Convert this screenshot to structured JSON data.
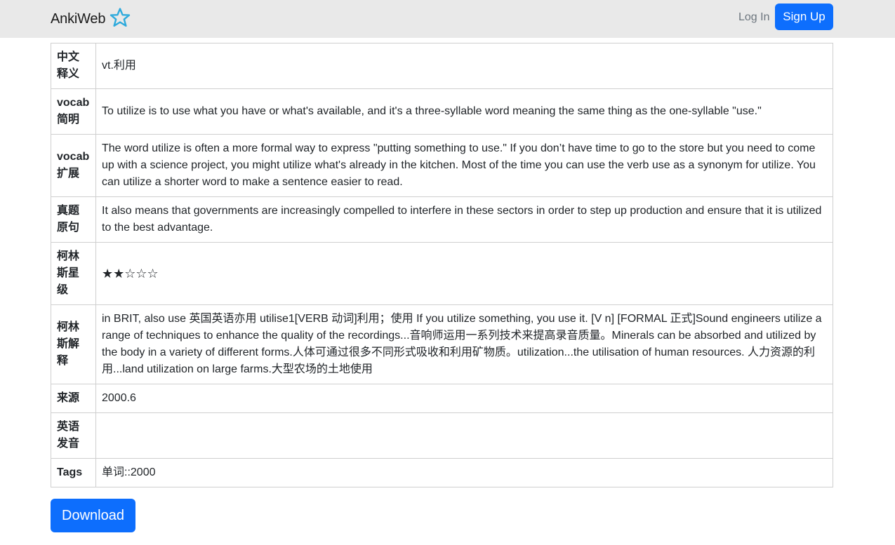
{
  "navbar": {
    "brand": "AnkiWeb",
    "brand_icon": "anki-star-icon",
    "brand_icon_color": "#2eaadc",
    "login_label": "Log In",
    "signup_label": "Sign Up",
    "accent": "#0d6efd"
  },
  "fields": [
    {
      "name": "中文释义",
      "value": "vt.利用"
    },
    {
      "name": "vocab简明",
      "value": "To utilize is to use what you have or what's available, and it's a three-syllable word meaning the same thing as the one-syllable \"use.\""
    },
    {
      "name": "vocab扩展",
      "value": "The word utilize is often a more formal way to express \"putting something to use.\" If you don’t have time to go to the store but you need to come up with a science project, you might utilize what's already in the kitchen. Most of the time you can use the verb use as a synonym for utilize. You can utilize a shorter word to make a sentence easier to read."
    },
    {
      "name": "真题原句",
      "value": "It also means that governments are increasingly compelled to interfere in these sectors in order to step up production and ensure that it is utilized to the best advantage."
    },
    {
      "name": "柯林斯星级",
      "value": "★★☆☆☆"
    },
    {
      "name": "柯林斯解释",
      "value": "in BRIT, also use 英国英语亦用 utilise1[VERB 动词]利用；使用 If you utilize something, you use it.   [V n]  [FORMAL 正式]Sound engineers utilize a range of techniques to enhance the quality of the recordings...音响师运用一系列技术来提高录音质量。Minerals can be absorbed and utilized by the body in a variety of different forms.人体可通过很多不同形式吸收和利用矿物质。utilization...the utilisation of human resources. 人力资源的利用...land utilization on large farms.大型农场的土地使用"
    },
    {
      "name": "来源",
      "value": "2000.6"
    },
    {
      "name": "英语发音",
      "value": ""
    },
    {
      "name": "Tags",
      "value": "单词::2000"
    }
  ],
  "download_label": "Download"
}
